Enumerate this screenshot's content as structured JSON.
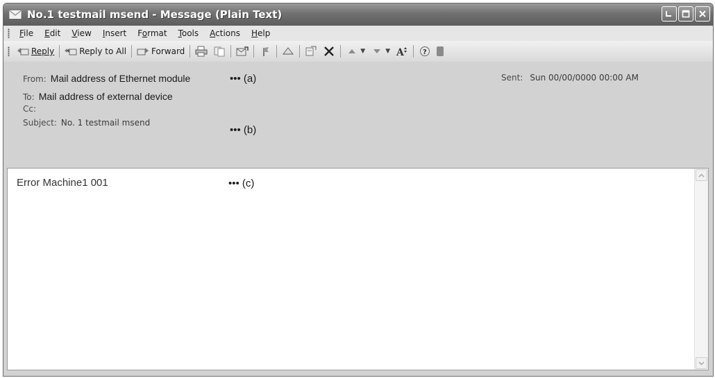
{
  "window": {
    "title": "No.1 testmail msend - Message (Plain Text)"
  },
  "menu": {
    "items": [
      {
        "label": "File",
        "accel": "F"
      },
      {
        "label": "Edit",
        "accel": "E"
      },
      {
        "label": "View",
        "accel": "V"
      },
      {
        "label": "Insert",
        "accel": "I"
      },
      {
        "label": "Format",
        "accel": "o"
      },
      {
        "label": "Tools",
        "accel": "T"
      },
      {
        "label": "Actions",
        "accel": "A"
      },
      {
        "label": "Help",
        "accel": "H"
      }
    ]
  },
  "toolbar": {
    "reply_label": "Reply",
    "reply_all_label": "Reply to All",
    "forward_label": "Forward",
    "icons": [
      "print-icon",
      "copy-icon",
      "move-to-folder-icon",
      "flag-icon",
      "categorize-icon",
      "junk-icon",
      "delete-icon",
      "previous-item-icon",
      "next-item-icon",
      "text-size-icon",
      "help-icon"
    ]
  },
  "header": {
    "from_label": "From:",
    "from_value": "Mail address of Ethernet module",
    "sent_label": "Sent:",
    "sent_value": "Sun 00/00/0000 00:00 AM",
    "to_label": "To:",
    "to_value": "Mail address of external device",
    "cc_label": "Cc:",
    "subject_label": "Subject:",
    "subject_value": "No. 1 testmail msend"
  },
  "callouts": {
    "a": "••• (a)",
    "b": "••• (b)",
    "c": "••• (c)"
  },
  "message": {
    "body": "Error Machine1 001"
  }
}
